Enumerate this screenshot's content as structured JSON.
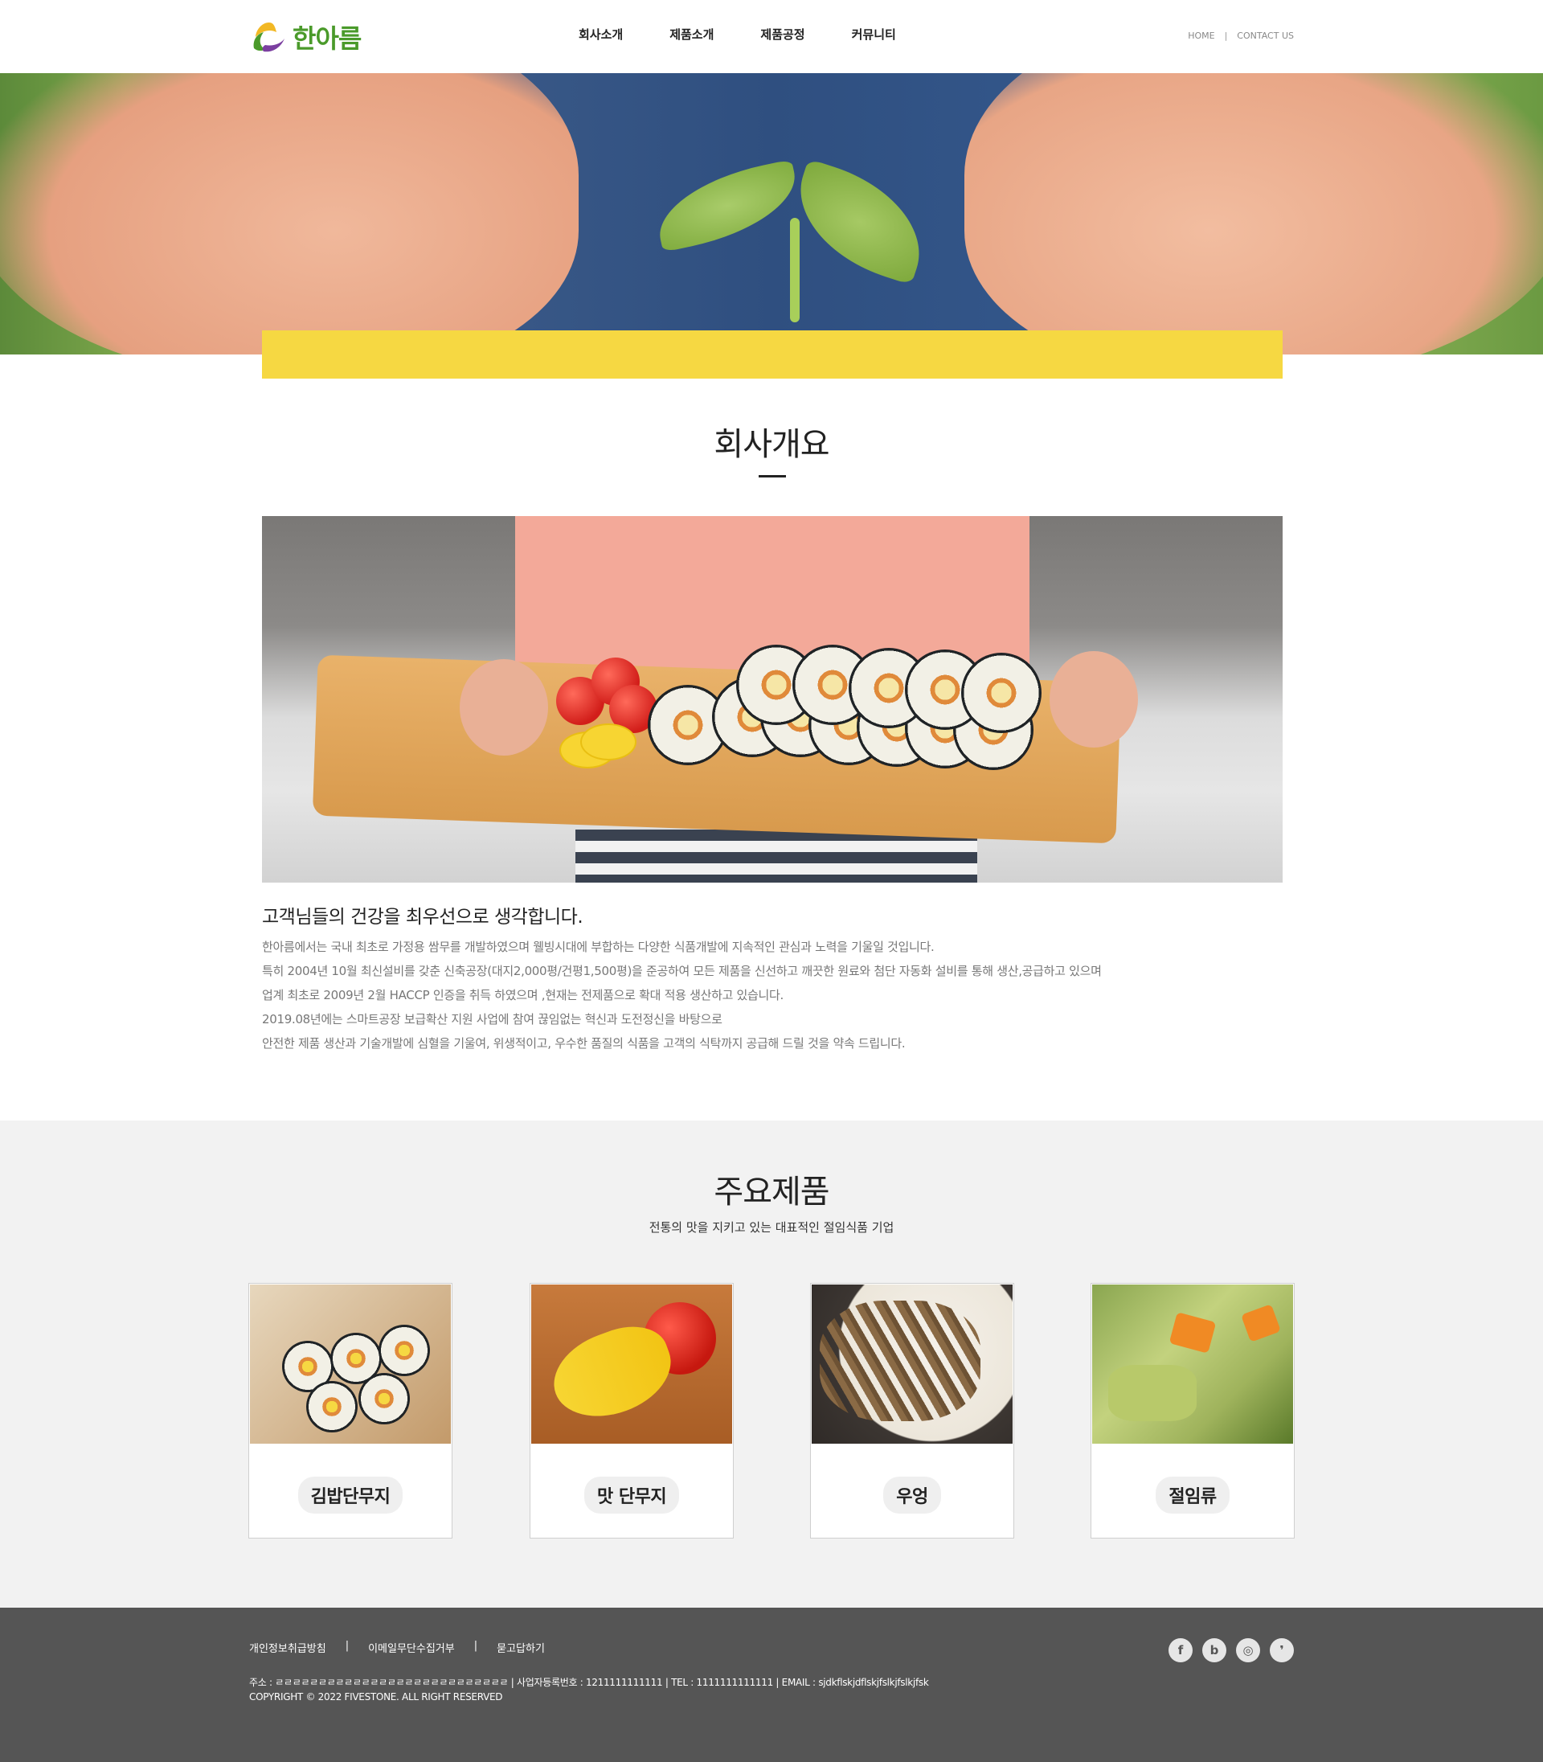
{
  "header": {
    "logo_text": "한아름",
    "nav": [
      "회사소개",
      "제품소개",
      "제품공정",
      "커뮤니티"
    ],
    "util": {
      "home": "HOME",
      "contact": "CONTACT US"
    }
  },
  "about": {
    "title": "회사개요",
    "headline": "고객님들의 건강을 최우선으로 생각합니다.",
    "paragraphs": [
      "한아름에서는 국내 최초로 가정용 쌈무를 개발하였으며 웰빙시대에 부합하는 다양한 식품개발에 지속적인 관심과 노력을 기울일 것입니다.",
      "특히 2004년 10월 최신설비를 갖춘 신축공장(대지2,000평/건평1,500평)을 준공하여 모든 제품을 신선하고 깨끗한 원료와 첨단 자동화 설비를 통해 생산,공급하고 있으며",
      "업계 최초로 2009년 2월 HACCP 인증을 취득 하였으며 ,현재는 전제품으로 확대 적용 생산하고 있습니다.",
      "2019.08년에는 스마트공장 보급확산 지원 사업에 참여 끊임없는 혁신과 도전정신을 바탕으로",
      "안전한 제품 생산과 기술개발에 심혈을 기울여, 위생적이고, 우수한 품질의 식품을 고객의 식탁까지 공급해 드릴 것을 약속 드립니다."
    ]
  },
  "products": {
    "title": "주요제품",
    "subtitle": "전통의 맛을 지키고 있는 대표적인 절임식품 기업",
    "items": [
      {
        "label": "김밥단무지"
      },
      {
        "label": "맛 단무지"
      },
      {
        "label": "우엉"
      },
      {
        "label": "절임류"
      }
    ]
  },
  "footer": {
    "links": [
      "개인정보취급방침",
      "이메일무단수집거부",
      "묻고답하기"
    ],
    "address": "주소 : ㄹㄹㄹㄹㄹㄹㄹㄹㄹㄹㄹㄹㄹㄹㄹㄹㄹㄹㄹㄹㄹㄹㄹㄹㄹㄹㄹ | 사업자등록번호 : 1211111111111 | TEL : 1111111111111 | EMAIL : sjdkflskjdflskjfslkjfslkjfsk",
    "copyright": "COPYRIGHT © 2022 FIVESTONE. ALL RIGHT RESERVED",
    "sns": [
      "f",
      "b",
      "◎",
      "❜"
    ]
  },
  "colors": {
    "accent_yellow": "#f6d842",
    "footer_bg": "#555555",
    "section_bg": "#f2f2f2",
    "logo_green": "#4a9a2a"
  },
  "icons": {
    "logo": "hanareum-logo-icon",
    "sns": [
      "facebook-icon",
      "blog-icon",
      "instagram-icon",
      "kakao-icon"
    ]
  }
}
